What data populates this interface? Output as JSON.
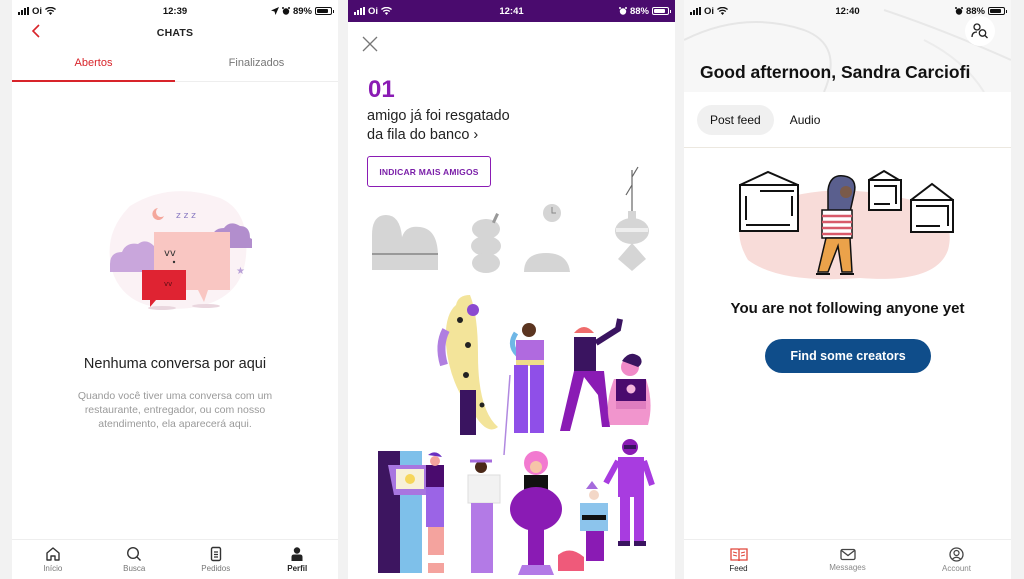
{
  "screens": [
    {
      "status": {
        "carrier": "Oi",
        "time": "12:39",
        "battery": "89%"
      },
      "header": {
        "title": "CHATS",
        "back_icon": "chevron-left-icon"
      },
      "tabs": [
        {
          "label": "Abertos",
          "active": true
        },
        {
          "label": "Finalizados",
          "active": false
        }
      ],
      "empty_state": {
        "title": "Nenhuma conversa por aqui",
        "description": "Quando você tiver uma conversa com um restaurante, entregador, ou com nosso atendimento, ela aparecerá aqui."
      },
      "bottom_nav": [
        {
          "label": "Início",
          "icon": "home-icon"
        },
        {
          "label": "Busca",
          "icon": "search-icon"
        },
        {
          "label": "Pedidos",
          "icon": "receipt-icon"
        },
        {
          "label": "Perfil",
          "icon": "person-icon",
          "active": true
        }
      ],
      "colors": {
        "accent": "#d8242a"
      }
    },
    {
      "status": {
        "carrier": "Oi",
        "time": "12:41",
        "battery": "88%"
      },
      "close_icon": "close-icon",
      "count": "01",
      "message_line1": "amigo já foi resgatado",
      "message_line2": "da fila do banco ›",
      "cta": "INDICAR MAIS AMIGOS",
      "colors": {
        "statusbar": "#4a0b6e",
        "accent": "#8a1bb4"
      }
    },
    {
      "status": {
        "carrier": "Oi",
        "time": "12:40",
        "battery": "88%"
      },
      "greeting": "Good afternoon, Sandra Carciofi",
      "tabs": [
        {
          "label": "Post feed",
          "active": true
        },
        {
          "label": "Audio",
          "active": false
        }
      ],
      "empty_state": {
        "title": "You are not following anyone yet",
        "cta": "Find some creators"
      },
      "bottom_nav": [
        {
          "label": "Feed",
          "icon": "book-icon",
          "active": true
        },
        {
          "label": "Messages",
          "icon": "mail-icon"
        },
        {
          "label": "Account",
          "icon": "account-icon"
        }
      ],
      "colors": {
        "button": "#0f4d8a",
        "feed_icon": "#e0463a"
      }
    }
  ]
}
